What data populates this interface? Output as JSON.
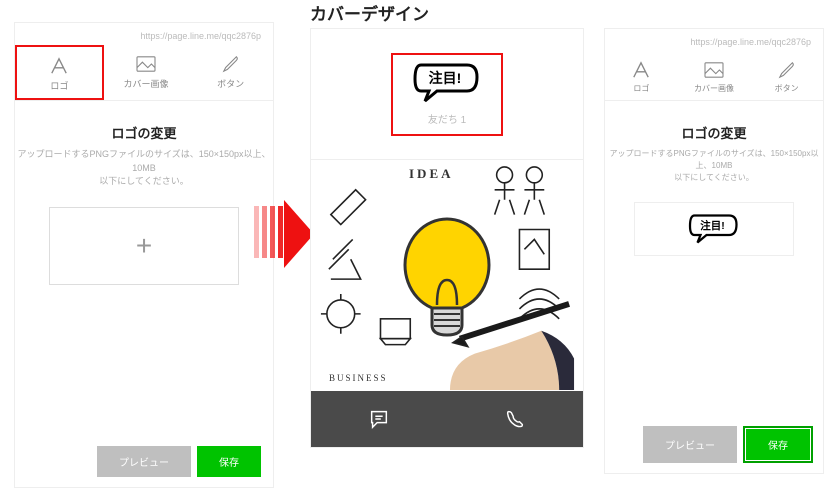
{
  "title": "カバーデザイン",
  "url": "https://page.line.me/qqc2876p",
  "tabs": {
    "logo": "ロゴ",
    "cover": "カバー画像",
    "button": "ボタン"
  },
  "section": {
    "title": "ロゴの変更",
    "sub": "アップロードするPNGファイルのサイズは、150×150px以上、10MB\n以下にしてください。"
  },
  "upload": {
    "plus": "+"
  },
  "buttons": {
    "preview": "プレビュー",
    "save": "保存"
  },
  "preview": {
    "friend": "友だち 1",
    "logo_text": "注目!"
  },
  "doodles": {
    "idea": "IDEA",
    "business": "BUSINESS"
  }
}
